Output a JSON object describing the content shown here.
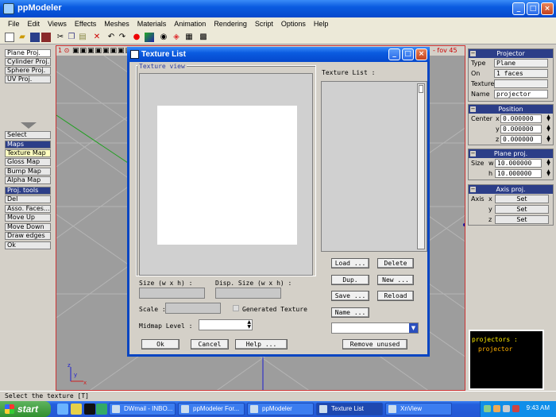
{
  "app": {
    "title": "ppModeler",
    "window_controls": [
      "_",
      "□",
      "×"
    ]
  },
  "menubar": [
    "File",
    "Edit",
    "Views",
    "Effects",
    "Meshes",
    "Materials",
    "Animation",
    "Rendering",
    "Script",
    "Options",
    "Help"
  ],
  "viewport": {
    "header_left": "1 ⊙",
    "header_right": "- fov 45"
  },
  "left_panel": {
    "projection_items": [
      "Plane Proj.",
      "Cylinder Proj.",
      "Sphere Proj.",
      "UV Proj."
    ],
    "tool_items": [
      "Select",
      "Maps",
      "Texture Map",
      "Gloss Map",
      "Bump Map",
      "Alpha Map",
      "Proj. tools",
      "Del",
      "Asso. Faces...",
      "Move Up",
      "Move Down",
      "Draw edges",
      "Ok"
    ]
  },
  "right_panel": {
    "projector": {
      "header": "Projector",
      "type_label": "Type",
      "type_value": "Plane",
      "on_label": "On",
      "on_value": "1 faces",
      "texture_label": "Texture",
      "texture_value": "",
      "name_label": "Name",
      "name_value": "projector"
    },
    "position": {
      "header": "Position",
      "center_label": "Center",
      "x_label": "x",
      "x_value": "0.000000",
      "y_label": "y",
      "y_value": "0.000000",
      "z_label": "z",
      "z_value": "0.000000"
    },
    "plane_proj": {
      "header": "Plane proj.",
      "size_label": "Size",
      "w_label": "w",
      "w_value": "10.000000",
      "h_label": "h",
      "h_value": "10.000000"
    },
    "axis_proj": {
      "header": "Axis proj.",
      "axis_label": "Axis",
      "x_label": "x",
      "y_label": "y",
      "z_label": "z",
      "set_label": "Set"
    },
    "output": {
      "line1": "projectors :",
      "line2": "projector"
    }
  },
  "status": {
    "text": "Select the texture [T]"
  },
  "dialog": {
    "title": "Texture List",
    "texture_view_label": "Texture view",
    "texture_list_label": "Texture List :",
    "size_label": "Size (w x h) :",
    "disp_size_label": "Disp. Size (w x h) :",
    "scale_label": "Scale :",
    "generated_texture_label": "Generated Texture",
    "midmap_label": "Midmap Level :",
    "buttons": {
      "load": "Load ...",
      "delete": "Delete",
      "dup": "Dup.",
      "new": "New ...",
      "save": "Save ...",
      "reload": "Reload",
      "name": "Name ...",
      "ok": "Ok",
      "cancel": "Cancel",
      "help": "Help ...",
      "remove_unused": "Remove unused"
    }
  },
  "taskbar": {
    "start_label": "start",
    "tasks": [
      "DWmail - INBO...",
      "ppModeler For...",
      "ppModeler",
      "Texture List",
      "XnView"
    ],
    "active_task": "Texture List",
    "clock": "9:43 AM"
  },
  "colors": {
    "title_blue": "#0a5be0",
    "panel_header": "#2c3e88",
    "viewport_bg": "#9d9d9d",
    "grid_line": "#b8b8b8",
    "axis_red": "#d02020",
    "axis_green": "#20a020",
    "axis_blue": "#2020d0"
  }
}
